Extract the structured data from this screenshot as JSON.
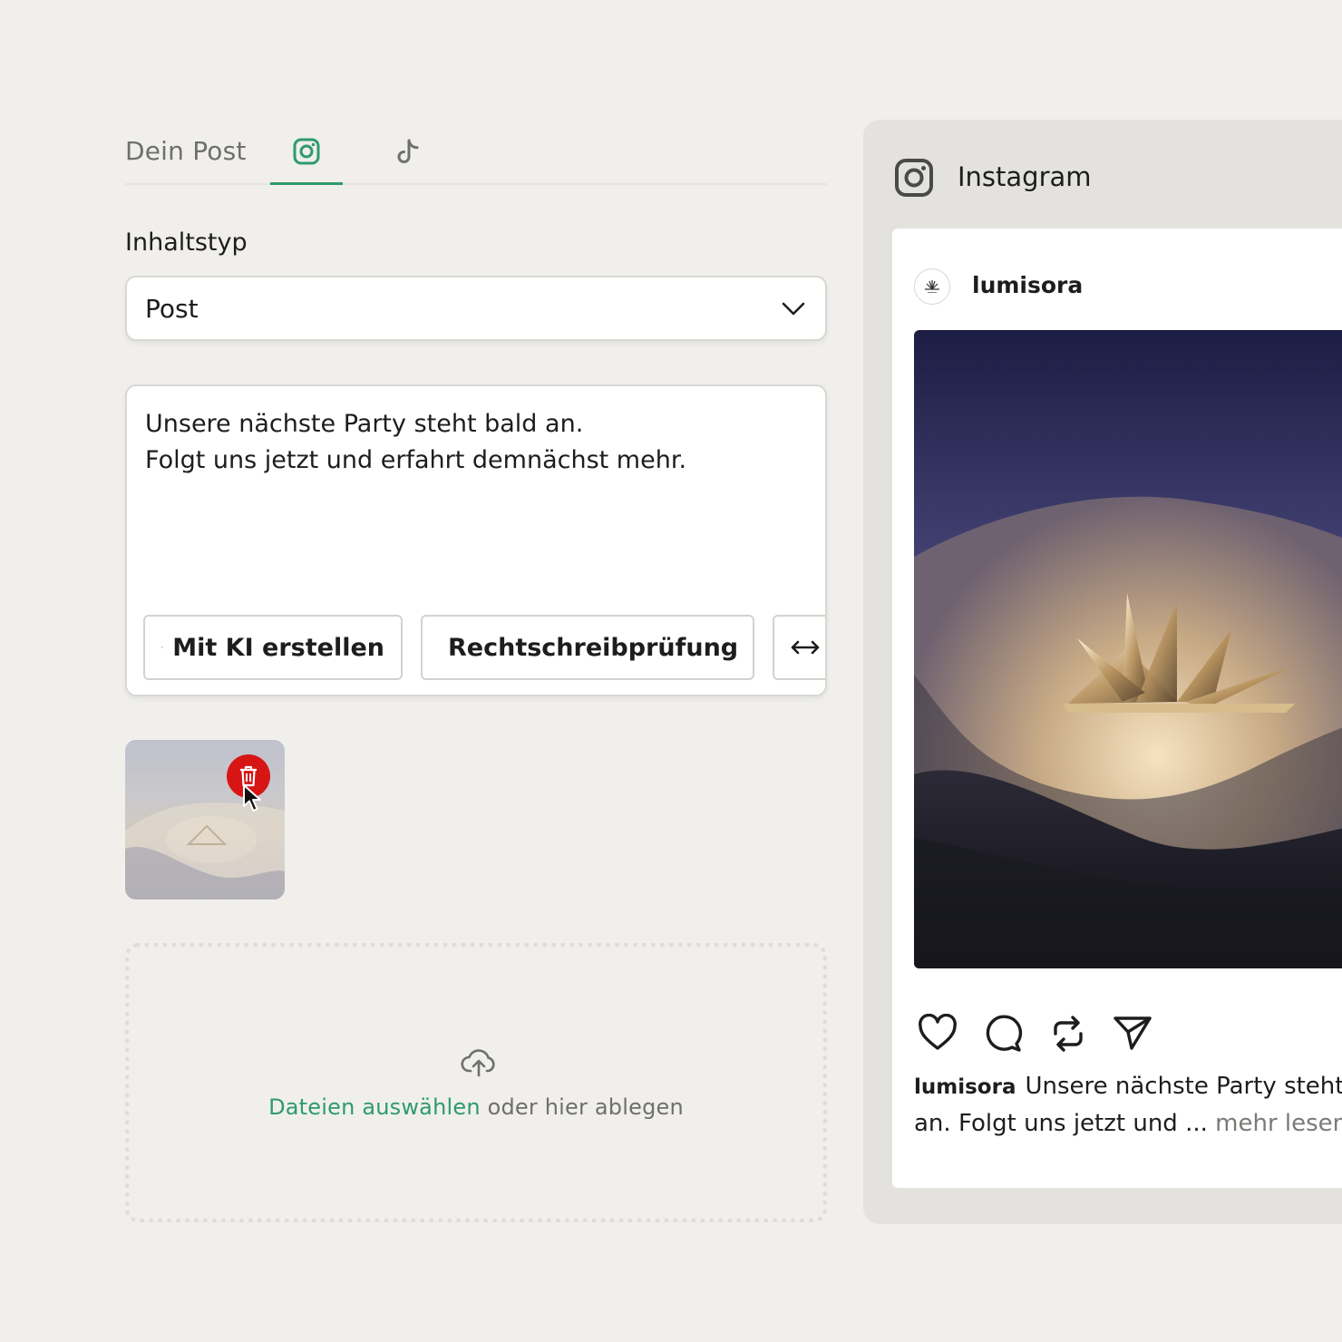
{
  "tabs": {
    "label": "Dein Post",
    "items": [
      {
        "icon": "instagram-icon",
        "active": true
      },
      {
        "icon": "tiktok-icon",
        "active": false
      }
    ]
  },
  "form": {
    "content_type_label": "Inhaltstyp",
    "content_type_value": "Post",
    "text_lines": [
      "Unsere nächste Party steht bald an.",
      "Folgt uns jetzt und erfahrt demnächst mehr."
    ],
    "buttons": {
      "ai": "Mit KI erstellen",
      "spell": "Rechtschreibprüfung"
    }
  },
  "dropzone": {
    "link": "Dateien auswählen",
    "text": " oder hier ablegen"
  },
  "preview": {
    "title": "Instagram",
    "username": "lumisora",
    "caption_user": "lumisora",
    "caption_line1": "Unsere nächste Party steht",
    "caption_line2": "an. Folgt uns jetzt und ...",
    "more": "mehr lesen"
  },
  "colors": {
    "accent": "#2e9b6a",
    "danger": "#d81515",
    "background": "#f0efec",
    "panel": "#e3e2de"
  }
}
